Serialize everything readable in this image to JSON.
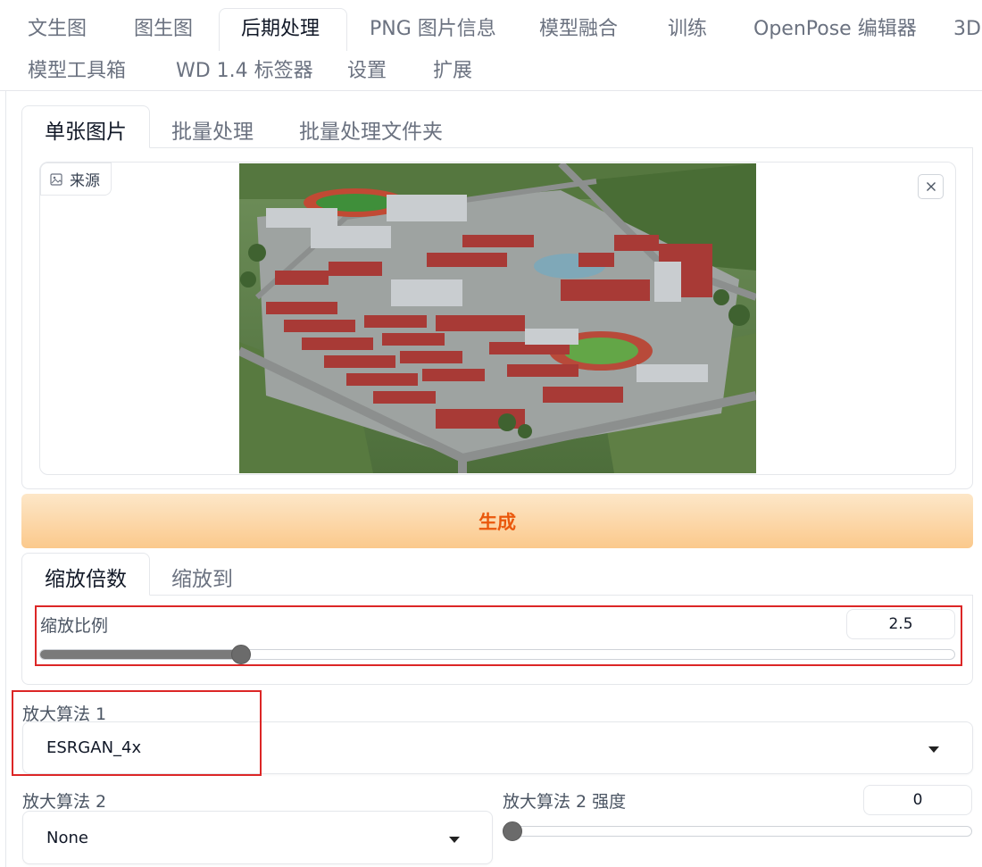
{
  "top_tabs": {
    "row1": [
      "文生图",
      "图生图",
      "后期处理",
      "PNG 图片信息",
      "模型融合",
      "训练",
      "OpenPose 编辑器",
      "3D"
    ],
    "row2": [
      "模型工具箱",
      "WD 1.4 标签器",
      "设置",
      "扩展"
    ],
    "active": "后期处理"
  },
  "sub_tabs": {
    "items": [
      "单张图片",
      "批量处理",
      "批量处理文件夹"
    ],
    "active": "单张图片"
  },
  "image_input": {
    "source_label": "来源",
    "source_icon": "image-icon",
    "close_icon": "close-icon"
  },
  "generate_button": {
    "label": "生成",
    "color": "#ea580c"
  },
  "scale_tabs": {
    "items": [
      "缩放倍数",
      "缩放到"
    ],
    "active": "缩放倍数"
  },
  "scale_ratio": {
    "label": "缩放比例",
    "value": "2.5",
    "slider_fraction": 0.22
  },
  "upscaler1": {
    "label": "放大算法 1",
    "value": "ESRGAN_4x"
  },
  "upscaler2": {
    "label": "放大算法 2",
    "value": "None"
  },
  "upscaler2_strength": {
    "label": "放大算法 2 强度",
    "value": "0",
    "slider_fraction": 0
  },
  "colors": {
    "highlight_box": "#dc2626",
    "accent": "#ea580c"
  }
}
